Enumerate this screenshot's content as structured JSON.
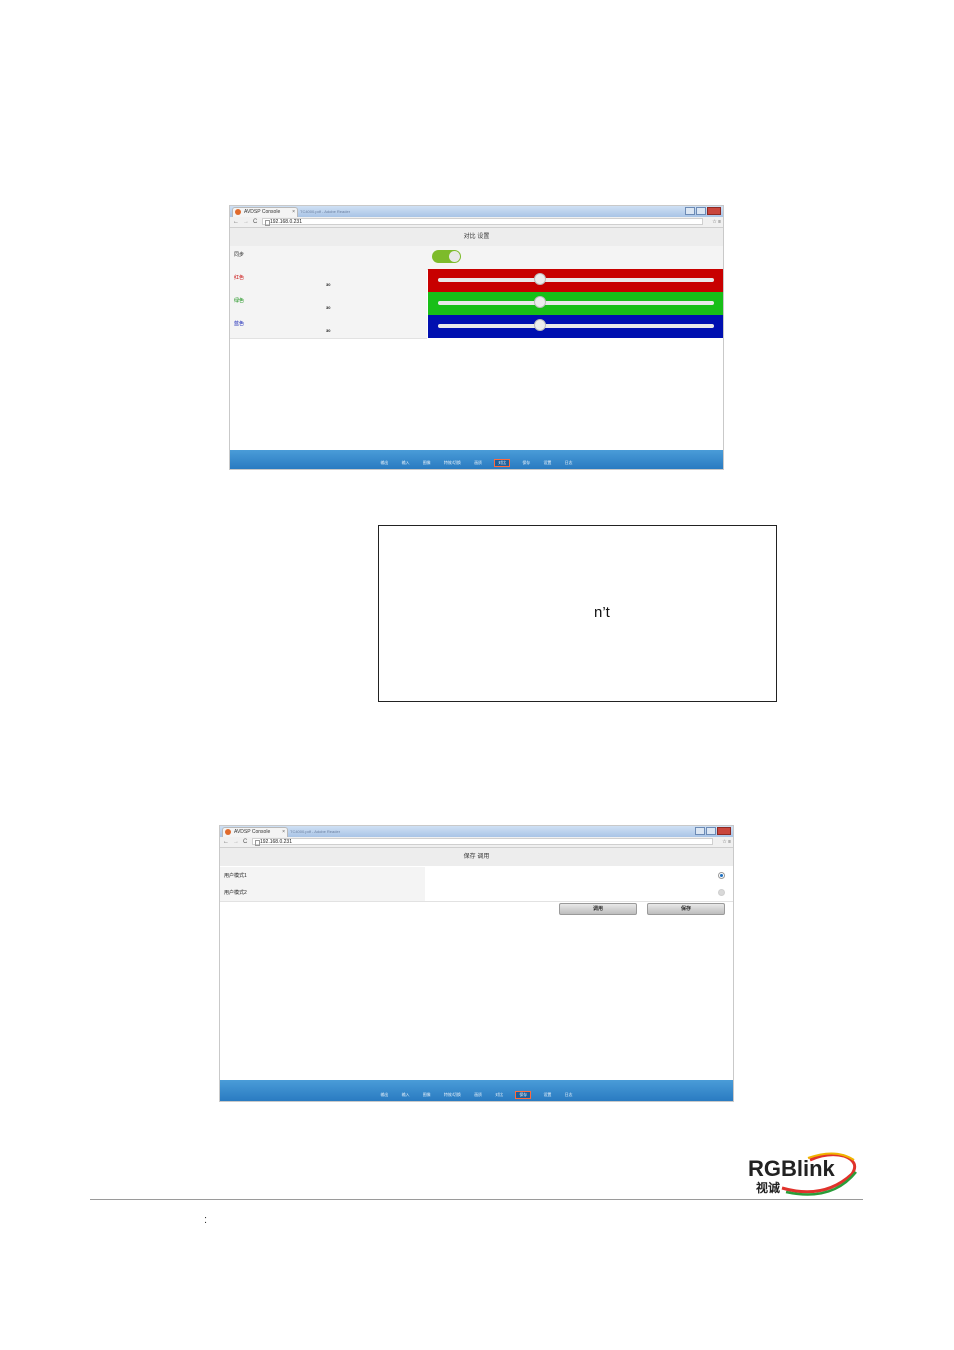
{
  "colors": {
    "red_panel": "#c80000",
    "green_panel": "#18bf18",
    "blue_panel": "#0010b0",
    "nav_bar": "#2f86cc",
    "toggle_on": "#7dbb2b",
    "red_label": "#c80000",
    "green_label": "#0a8a0a",
    "blue_label": "#0010b0"
  },
  "screenshot1": {
    "tab_title": "AVDSP Console",
    "tab_close": "×",
    "ghost_tab": "TC4000.pdf - Adobe Reader",
    "url": "192.168.0.231",
    "page_title": "对比 设置",
    "sync_label": "同步",
    "sync_on": true,
    "rows": [
      {
        "label": "红色",
        "value": "30",
        "slider_fraction": 0.37
      },
      {
        "label": "绿色",
        "value": "30",
        "slider_fraction": 0.37
      },
      {
        "label": "蓝色",
        "value": "30",
        "slider_fraction": 0.37
      }
    ],
    "nav": [
      "输出",
      "输入",
      "图像",
      "特效/切换",
      "画质",
      "对比",
      "保存",
      "设置",
      "日志"
    ],
    "nav_active": "对比"
  },
  "note": {
    "text": "n’t"
  },
  "screenshot2": {
    "tab_title": "AVDSP Console",
    "tab_close": "×",
    "ghost_tab": "TC4000.pdf - Adobe Reader",
    "url": "192.168.0.231",
    "page_title": "保存 调用",
    "rows": [
      {
        "label": "用户模式1",
        "selected": true
      },
      {
        "label": "用户模式2",
        "selected": false
      }
    ],
    "recall_button": "调用",
    "save_button": "保存",
    "nav": [
      "输出",
      "输入",
      "图像",
      "特效/切换",
      "画质",
      "对比",
      "保存",
      "设置",
      "日志"
    ],
    "nav_active": "保存"
  },
  "logo": {
    "brand": "RGBlink",
    "sub": "视诚"
  },
  "footer": {
    "mark": ":"
  }
}
